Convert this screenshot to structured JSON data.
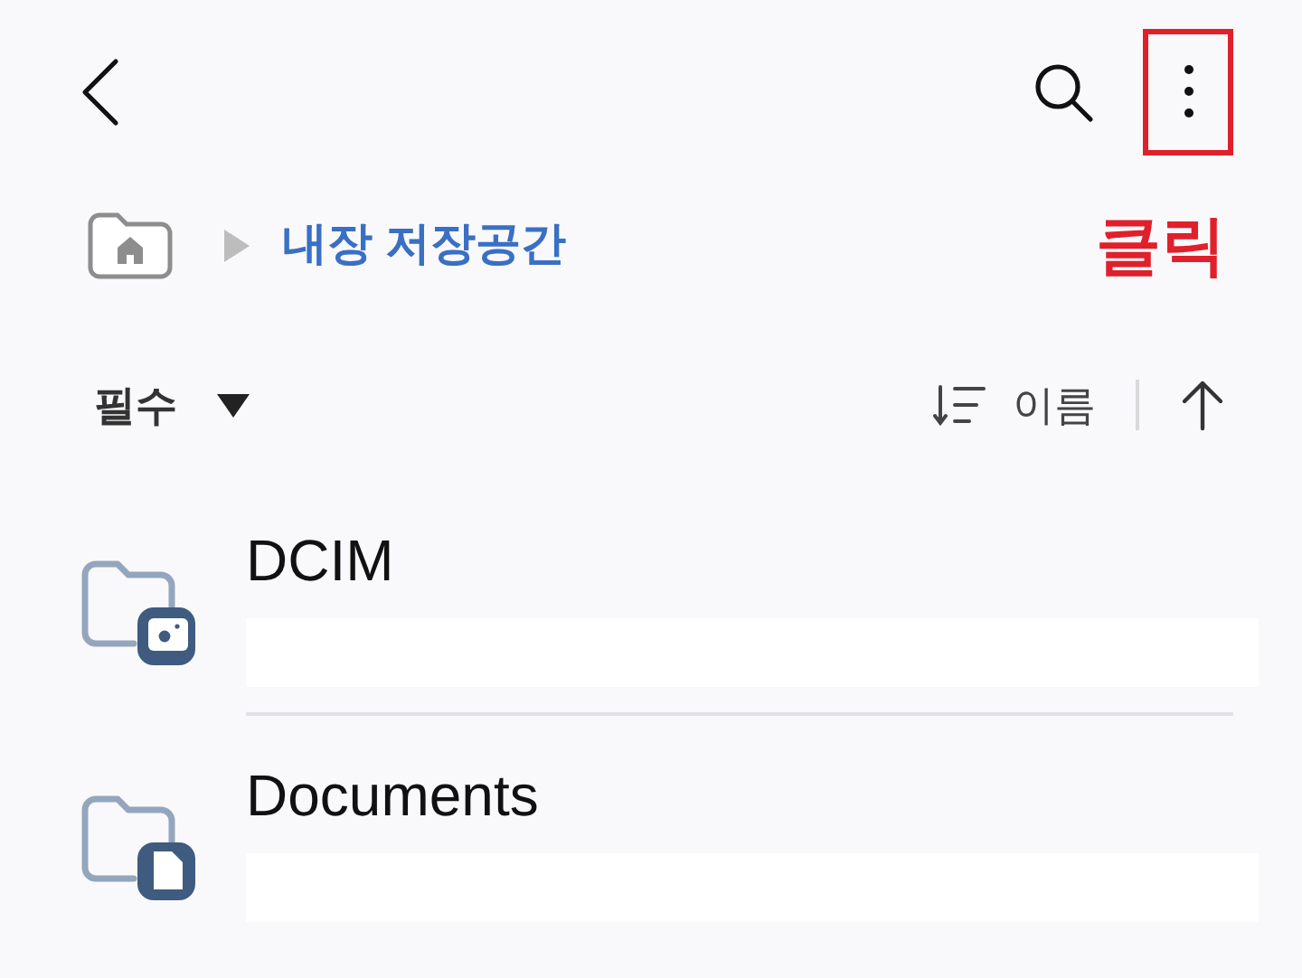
{
  "breadcrumb": {
    "current": "내장 저장공간"
  },
  "annotation": {
    "label": "클릭"
  },
  "sort_bar": {
    "filter": "필수",
    "sort_label": "이름"
  },
  "items": [
    {
      "name": "DCIM",
      "kind": "camera"
    },
    {
      "name": "Documents",
      "kind": "document"
    }
  ]
}
